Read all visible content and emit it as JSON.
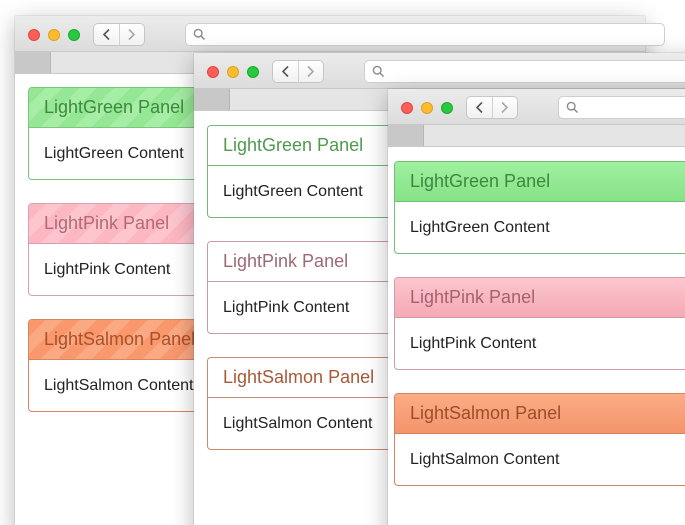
{
  "windows": [
    {
      "id": "w1",
      "style": "striped",
      "panels": [
        {
          "title": "LightGreen Panel",
          "content": "LightGreen Content"
        },
        {
          "title": "LightPink Panel",
          "content": "LightPink Content"
        },
        {
          "title": "LightSalmon Panel",
          "content": "LightSalmon Content"
        }
      ]
    },
    {
      "id": "w2",
      "style": "plain",
      "panels": [
        {
          "title": "LightGreen Panel",
          "content": "LightGreen Content"
        },
        {
          "title": "LightPink Panel",
          "content": "LightPink Content"
        },
        {
          "title": "LightSalmon Panel",
          "content": "LightSalmon Content"
        }
      ]
    },
    {
      "id": "w3",
      "style": "gradient",
      "panels": [
        {
          "title": "LightGreen Panel",
          "content": "LightGreen Content"
        },
        {
          "title": "LightPink Panel",
          "content": "LightPink Content"
        },
        {
          "title": "LightSalmon Panel",
          "content": "LightSalmon Content"
        }
      ]
    }
  ],
  "icons": {
    "back": "chevron-left-icon",
    "forward": "chevron-right-icon",
    "search": "search-icon"
  },
  "colors": {
    "lightgreen": "#90ee90",
    "lightpink": "#ffb6c1",
    "lightsalmon": "#ffa07a",
    "close": "#fc5f57",
    "minimize": "#fdbc2e",
    "zoom": "#28c840"
  }
}
